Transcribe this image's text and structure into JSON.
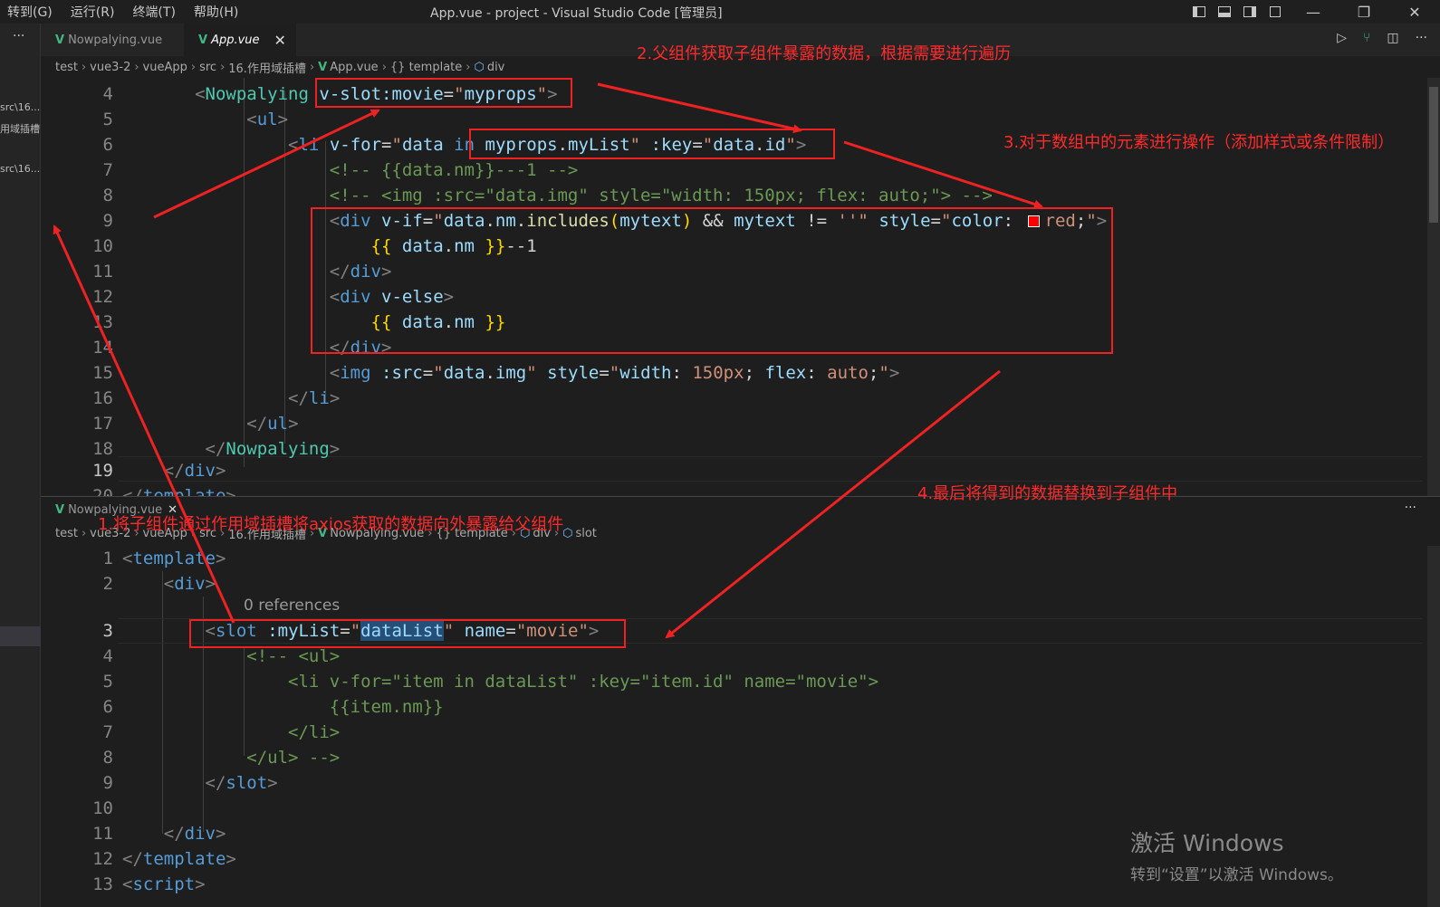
{
  "menu": [
    "转到(G)",
    "运行(R)",
    "终端(T)",
    "帮助(H)"
  ],
  "window_title": "App.vue - project - Visual Studio Code [管理员]",
  "window_buttons": {
    "minimize": "—",
    "restore": "❐",
    "close": "✕"
  },
  "sidebar": {
    "dots": "···",
    "items": [
      "src\\16...",
      "用域插槽",
      "src\\16..."
    ]
  },
  "top_editor": {
    "tabs": [
      {
        "label": "Nowpalying.vue",
        "active": false
      },
      {
        "label": "App.vue",
        "active": true
      }
    ],
    "close_glyph": "✕",
    "breadcrumb": [
      "test",
      "vue3-2",
      "vueApp",
      "src",
      "16.作用域插槽",
      "App.vue",
      "{} template",
      "div"
    ],
    "line_numbers": [
      "4",
      "5",
      "6",
      "7",
      "8",
      "9",
      "10",
      "11",
      "12",
      "13",
      "14",
      "15",
      "16",
      "17",
      "18",
      "19",
      "20"
    ],
    "current_line": "19"
  },
  "bottom_editor": {
    "tab_label": "Nowpalying.vue",
    "breadcrumb": [
      "test",
      "vue3-2",
      "vueApp",
      "src",
      "16.作用域插槽",
      "Nowpalying.vue",
      "{} template",
      "div",
      "slot"
    ],
    "line_numbers": [
      "1",
      "2",
      "3",
      "4",
      "5",
      "6",
      "7",
      "8",
      "9",
      "10",
      "11",
      "12",
      "13"
    ],
    "current_line": "3",
    "codelens": "0 references",
    "more": "···"
  },
  "annotations": {
    "note1": "1.将子组件通过作用域插槽将axios获取的数据向外暴露给父组件",
    "note2": "2.父组件获取子组件暴露的数据，根据需要进行遍历",
    "note3": "3.对于数组中的元素进行操作（添加样式或条件限制）",
    "note4": "4.最后将得到的数据替换到子组件中",
    "color": "#ee2222"
  },
  "watermark": {
    "line1": "激活 Windows",
    "line2": "转到“设置”以激活 Windows。"
  },
  "colors": {
    "editor_bg": "#1e1e1e",
    "tag": "#569cd6",
    "component": "#4ec9b0",
    "attribute": "#9cdcfe",
    "string": "#ce9178",
    "comment": "#6a9955",
    "vue_icon": "#41b883"
  }
}
